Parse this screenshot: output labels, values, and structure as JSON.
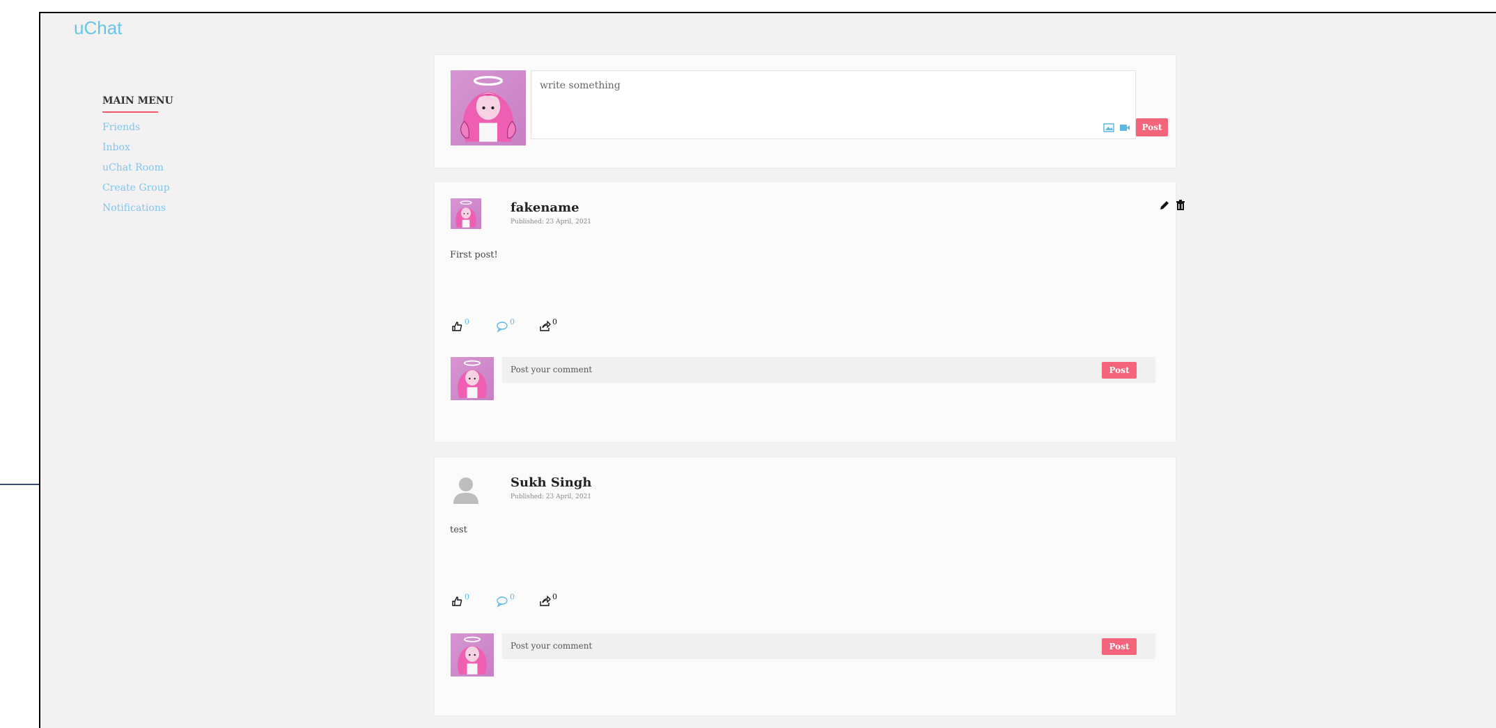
{
  "app": {
    "title": "uChat"
  },
  "menu": {
    "title": "MAIN MENU",
    "items": [
      {
        "label": "Friends"
      },
      {
        "label": "Inbox"
      },
      {
        "label": "uChat Room"
      },
      {
        "label": "Create Group"
      },
      {
        "label": "Notifications"
      }
    ]
  },
  "composer": {
    "placeholder": "write something",
    "post_label": "Post",
    "icons": [
      "image-icon",
      "video-icon"
    ]
  },
  "posts": [
    {
      "author": "fakename",
      "published": "Published: 23 April, 2021",
      "body": "First post!",
      "likes": "0",
      "comments": "0",
      "shares": "0",
      "comment_placeholder": "Post your comment",
      "comment_post_label": "Post",
      "has_custom_avatar": true,
      "owner_actions": [
        "edit-icon",
        "delete-icon"
      ]
    },
    {
      "author": "Sukh Singh",
      "published": "Published: 23 April, 2021",
      "body": "test",
      "likes": "0",
      "comments": "0",
      "shares": "0",
      "comment_placeholder": "Post your comment",
      "comment_post_label": "Post",
      "has_custom_avatar": false
    }
  ],
  "colors": {
    "accent": "#f4647b",
    "link": "#7ec6ee",
    "brand": "#66c6ea",
    "background": "#f3f1f1",
    "card": "#fbfbfb",
    "avatar_bg": "#d696d2"
  }
}
